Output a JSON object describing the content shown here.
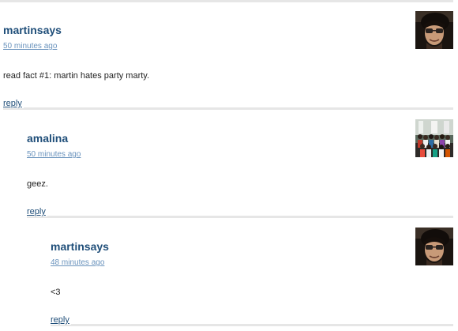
{
  "comments": [
    {
      "author": "martinsays",
      "time": "50 minutes ago",
      "text": "read fact #1: martin hates party marty.",
      "reply_label": "reply",
      "avatar": "avatar-photo-sunglasses-man"
    },
    {
      "author": "amalina",
      "time": "50 minutes ago",
      "text": "geez.",
      "reply_label": "reply",
      "avatar": "avatar-photo-group"
    },
    {
      "author": "martinsays",
      "time": "48 minutes ago",
      "text": "<3",
      "reply_label": "reply",
      "avatar": "avatar-photo-sunglasses-man"
    }
  ],
  "colors": {
    "link": "#1f4e79",
    "timestamp": "#6a93bd",
    "divider": "#e6e6e6"
  }
}
